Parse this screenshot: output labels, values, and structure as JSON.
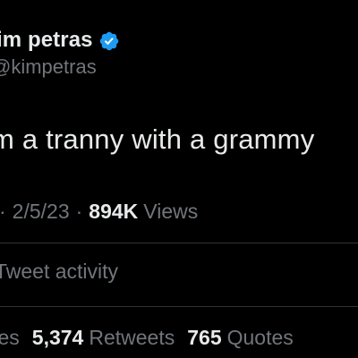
{
  "colors": {
    "background": "#000000",
    "primary_text": "#e7e9ea",
    "secondary_text": "#71767b",
    "divider": "#2f3336",
    "verified_badge": "#1d9bf0"
  },
  "author": {
    "display_name": "im petras",
    "handle": "@kimpetras",
    "badge_icon": "verified-badge-icon"
  },
  "tweet": {
    "text": "m a tranny with a grammy"
  },
  "meta": {
    "separator_left": "·",
    "date": "2/5/23",
    "separator_right": "·",
    "views_count": "894K",
    "views_label": "Views"
  },
  "activity": {
    "label": "Tweet activity"
  },
  "stats": {
    "likes_label": "kes",
    "retweets_count": "5,374",
    "retweets_label": "Retweets",
    "quotes_count": "765",
    "quotes_label": "Quotes"
  }
}
